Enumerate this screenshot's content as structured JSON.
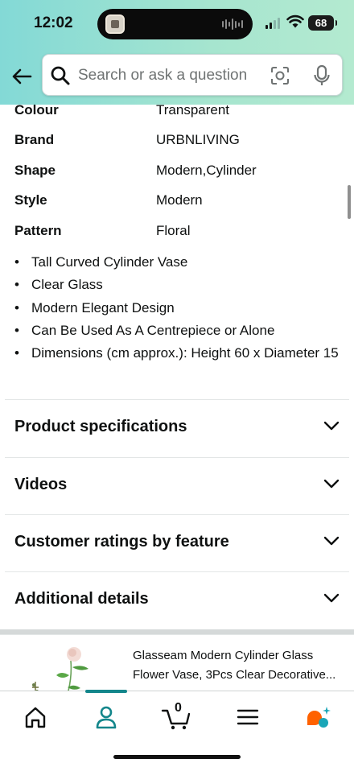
{
  "status": {
    "time": "12:02",
    "battery": "68"
  },
  "search": {
    "placeholder": "Search or ask a question"
  },
  "specs": [
    {
      "key": "Colour",
      "value": "Transparent"
    },
    {
      "key": "Brand",
      "value": "URBNLIVING"
    },
    {
      "key": "Shape",
      "value": "Modern,Cylinder"
    },
    {
      "key": "Style",
      "value": "Modern"
    },
    {
      "key": "Pattern",
      "value": "Floral"
    }
  ],
  "bullets": [
    "Tall Curved Cylinder Vase",
    "Clear Glass",
    "Modern Elegant Design",
    "Can Be Used As A Centrepiece or Alone",
    "Dimensions (cm approx.): Height 60 x Diameter 15"
  ],
  "sections": [
    "Product specifications",
    "Videos",
    "Customer ratings by feature",
    "Additional details"
  ],
  "product_card": {
    "title_line1": "Glasseam Modern Cylinder Glass",
    "title_line2": "Flower Vase, 3Pcs Clear Decorative..."
  },
  "tabbar": {
    "active": "account",
    "cart_count": "0",
    "items": [
      "home-icon",
      "account-icon",
      "cart-icon",
      "menu-icon",
      "rufus-icon"
    ]
  },
  "colors": {
    "accent": "#13868b",
    "header": "#a6e5cf",
    "rufus": "#ff6200"
  }
}
